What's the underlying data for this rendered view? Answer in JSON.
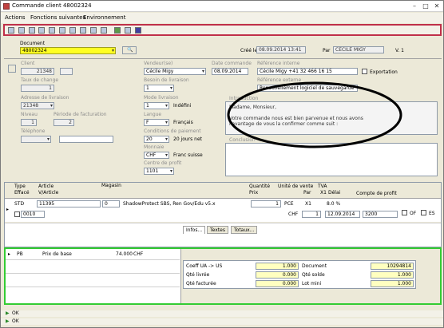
{
  "window": {
    "title": "Commande client 48002324"
  },
  "menu": [
    "Actions",
    "Fonctions suivantes",
    "Environnement"
  ],
  "header": {
    "document_label": "Document",
    "document_value": "48002324",
    "created_label": "Créé le",
    "created_value": "08.09.2014 13:41",
    "by_label": "Par",
    "by_value": "CECILE MIGY",
    "version": "V. 1"
  },
  "left": {
    "client_label": "Client",
    "client_value": "21348",
    "taux_label": "Taux de change",
    "taux_value": "1",
    "adresse_label": "Adresse de livraison",
    "adresse_value": "21348",
    "niveau_label": "Niveau",
    "niveau_value": "1",
    "facturation_label": "Période de facturation",
    "facturation_value": "2",
    "telephone_label": "Téléphone"
  },
  "middle": {
    "vendeur_label": "Vendeur(se)",
    "vendeur_value": "Cécile Migy",
    "besoin_label": "Besoin de livraison",
    "besoin_value": "1",
    "mode_label": "Mode livraison",
    "mode_value": "1",
    "mode_text": "Indéfini",
    "langue_label": "Langue",
    "langue_value": "F",
    "langue_text": "Français",
    "conditions_label": "Conditions de paiement",
    "conditions_value": "20",
    "conditions_text": "20 jours net",
    "monnaie_label": "Monnaie",
    "monnaie_value": "CHF",
    "monnaie_text": "Franc suisse",
    "centre_label": "Centre de profit",
    "centre_value": "1101"
  },
  "right": {
    "date_label": "Date commande",
    "date_value": "08.09.2014",
    "ref_label": "Référence interne",
    "ref_value": "Cécile Migy +41 32 466 16 15",
    "export_label": "Exportation",
    "ref_ext_label": "Référence externe",
    "ref_ext_value": "Renouvellement logiciel de sauvegarde",
    "intro_label": "Introduction",
    "intro_text": "Madame, Monsieur,\n\nVotre commande nous est bien parvenue et nous avons l'avantage de vous la confirmer comme suit :",
    "conclusion_label": "Conclusion"
  },
  "grid": {
    "headers": [
      "Type",
      "Article",
      "Magasin",
      "Quantité",
      "Unité de vente",
      "TVA",
      "Compte de profit"
    ],
    "headers2": [
      "Effacé",
      "V/Article",
      "Prix",
      "Par",
      "X1",
      "Délai"
    ],
    "row": {
      "type": "STD",
      "article": "11395",
      "magasin": "0",
      "desc": "ShadowProtect SBS, Ren Gov/Edu v5.x",
      "qty": "1",
      "unit": "PCE",
      "factor": "X1",
      "tva": "8.0 %",
      "article2": "0010",
      "currency": "CHF",
      "per": "1",
      "delai": "12.09.2014",
      "compte": "3200",
      "of_label": "OF",
      "es_label": "ES"
    }
  },
  "bottom": {
    "pb": "PB",
    "pb_label": "Prix de base",
    "pb_value": "74.000",
    "pb_cur": "CHF",
    "tabs": [
      "Infos...",
      "Textes",
      "Totaux..."
    ],
    "fields": [
      {
        "label": "Coeff UA -> US",
        "value": "1.000"
      },
      {
        "label": "Qté livrée",
        "value": "0.000"
      },
      {
        "label": "Qté facturée",
        "value": "0.000"
      }
    ],
    "fields2": [
      {
        "label": "Document",
        "value": "10294814"
      },
      {
        "label": "Qté solde",
        "value": "1.000"
      },
      {
        "label": "Lot mini",
        "value": "1.000"
      }
    ]
  },
  "status": [
    "OK",
    "OK"
  ]
}
